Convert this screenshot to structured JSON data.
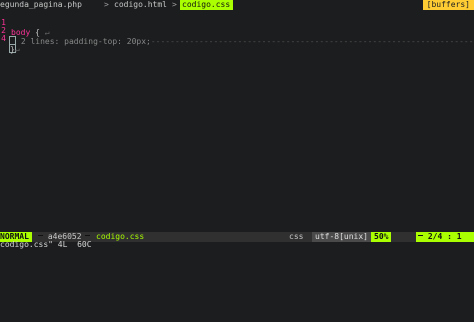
{
  "tabs": [
    {
      "label": "egunda_pagina.php",
      "active": false
    },
    {
      "label": "codigo.html",
      "active": false
    },
    {
      "label": "codigo.css",
      "active": true
    }
  ],
  "tab_separator": ">",
  "buffers_label": "[buffers]",
  "lines": [
    {
      "number": "1",
      "selector": "body",
      "brace": " {",
      "eol": "↵"
    },
    {
      "number": "2",
      "fold_text": " 2 lines: padding-top: 20px;",
      "fill": "----------------------------------------------------------------------"
    },
    {
      "number": "4",
      "cursor_char": "}",
      "eol": "↵"
    }
  ],
  "status": {
    "mode": "NORMAL",
    "branch_icon": "branch-icon",
    "branch": "a4e6052",
    "filename": "codigo.css",
    "filetype": "css",
    "encoding": "utf-8[unix]",
    "percent": "50%",
    "position": "2/4 : 1"
  },
  "cmdline": "codigo.css\" 4L  60C",
  "colors": {
    "accent": "#aaff00",
    "line_number": "#ff3399",
    "buffers": "#ffcc33",
    "background": "#1b1d1e"
  }
}
